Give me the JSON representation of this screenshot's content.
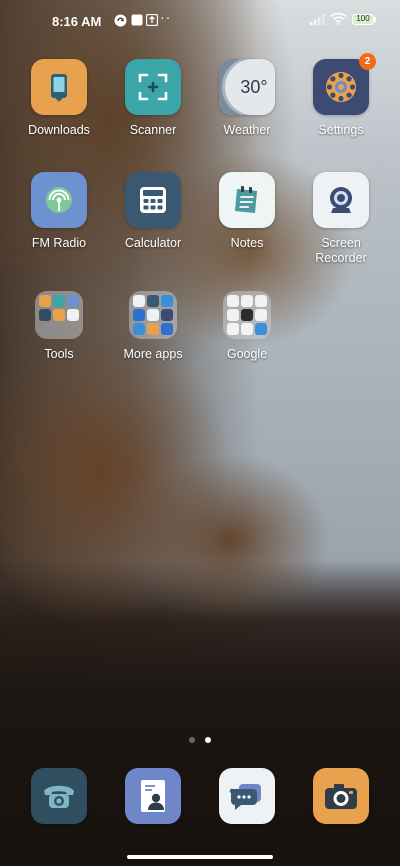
{
  "status_bar": {
    "time": "8:16 AM",
    "battery_level": "100",
    "more_indicator": "··"
  },
  "apps": [
    {
      "label": "Downloads",
      "icon": "download-phone-icon",
      "color": "#e8a24e"
    },
    {
      "label": "Scanner",
      "icon": "scan-frame-icon",
      "color": "#3aa6a8"
    },
    {
      "label": "Weather",
      "icon": "weather-icon",
      "value": "30°",
      "color": "#d8dbe0"
    },
    {
      "label": "Settings",
      "icon": "gear-icon",
      "badge": "2",
      "color": "#3c4a74"
    },
    {
      "label": "FM Radio",
      "icon": "radio-icon",
      "color": "#6e91cf"
    },
    {
      "label": "Calculator",
      "icon": "calculator-icon",
      "color": "#3b5873"
    },
    {
      "label": "Notes",
      "icon": "notes-icon",
      "color": "#eff4f4"
    },
    {
      "label": "Screen\nRecorder",
      "icon": "camera-record-icon",
      "color": "#eef2f4"
    }
  ],
  "folders": [
    {
      "label": "Tools"
    },
    {
      "label": "More apps"
    },
    {
      "label": "Google"
    }
  ],
  "dock": [
    {
      "name": "Phone",
      "icon": "phone-icon",
      "color": "#2f4f61"
    },
    {
      "name": "Contacts",
      "icon": "contacts-icon",
      "color": "#6f86c9"
    },
    {
      "name": "Messages",
      "icon": "message-icon",
      "color": "#eef2f4"
    },
    {
      "name": "Camera",
      "icon": "camera-icon",
      "color": "#e8a24e"
    }
  ],
  "page_indicator": {
    "pages": 2,
    "active": 2
  }
}
